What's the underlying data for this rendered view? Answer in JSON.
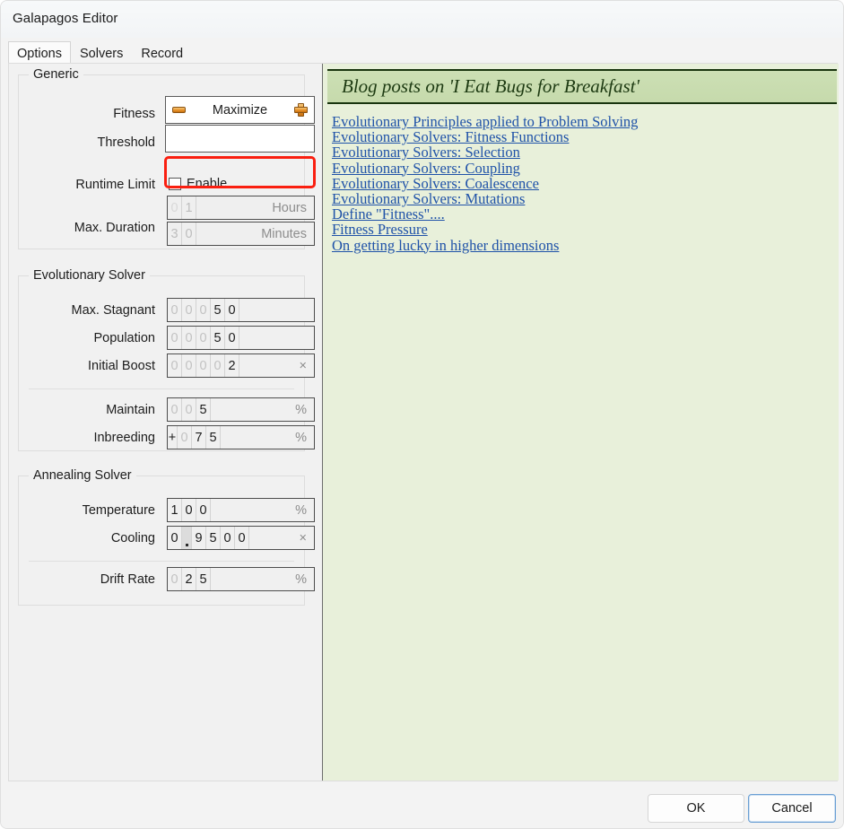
{
  "window": {
    "title": "Galapagos Editor"
  },
  "tabs": [
    {
      "label": "Options",
      "active": true
    },
    {
      "label": "Solvers",
      "active": false
    },
    {
      "label": "Record",
      "active": false
    }
  ],
  "generic": {
    "title": "Generic",
    "fitness": {
      "label": "Fitness",
      "value": "Maximize",
      "minus_icon": "minus-icon",
      "plus_icon": "plus-icon"
    },
    "threshold": {
      "label": "Threshold",
      "value": "",
      "placeholder": ""
    },
    "runtime_limit": {
      "label": "Runtime Limit",
      "checkbox_label": "Enable",
      "checked": false
    },
    "max_duration": {
      "label": "Max. Duration",
      "hours": {
        "digits": [
          "0",
          "1"
        ],
        "dim": [
          true,
          false
        ],
        "unit": "Hours",
        "disabled": true
      },
      "minutes": {
        "digits": [
          "3",
          "0"
        ],
        "dim": [
          false,
          false
        ],
        "unit": "Minutes",
        "disabled": true
      }
    }
  },
  "evolutionary": {
    "title": "Evolutionary Solver",
    "max_stagnant": {
      "label": "Max. Stagnant",
      "digits": [
        "0",
        "0",
        "0",
        "5",
        "0"
      ],
      "dim": [
        true,
        true,
        true,
        false,
        false
      ],
      "unit": ""
    },
    "population": {
      "label": "Population",
      "digits": [
        "0",
        "0",
        "0",
        "5",
        "0"
      ],
      "dim": [
        true,
        true,
        true,
        false,
        false
      ],
      "unit": ""
    },
    "initial_boost": {
      "label": "Initial Boost",
      "digits": [
        "0",
        "0",
        "0",
        "0",
        "2"
      ],
      "dim": [
        true,
        true,
        true,
        true,
        false
      ],
      "unit": "×"
    },
    "maintain": {
      "label": "Maintain",
      "digits": [
        "0",
        "0",
        "5"
      ],
      "dim": [
        true,
        true,
        false
      ],
      "unit": "%"
    },
    "inbreeding": {
      "label": "Inbreeding",
      "sign": "+",
      "digits": [
        "0",
        "7",
        "5"
      ],
      "dim": [
        true,
        false,
        false
      ],
      "unit": "%"
    }
  },
  "annealing": {
    "title": "Annealing Solver",
    "temperature": {
      "label": "Temperature",
      "digits": [
        "1",
        "0",
        "0"
      ],
      "dim": [
        false,
        false,
        false
      ],
      "unit": "%"
    },
    "cooling": {
      "label": "Cooling",
      "digits": [
        "0",
        ".",
        "9",
        "5",
        "0",
        "0"
      ],
      "dim": [
        false,
        false,
        false,
        false,
        false,
        false
      ],
      "unit": "×"
    },
    "drift_rate": {
      "label": "Drift Rate",
      "digits": [
        "0",
        "2",
        "5"
      ],
      "dim": [
        true,
        false,
        false
      ],
      "unit": "%"
    }
  },
  "blog": {
    "banner": "Blog posts on 'I Eat Bugs for Breakfast'",
    "links": [
      "Evolutionary Principles applied to Problem Solving",
      "Evolutionary Solvers: Fitness Functions",
      "Evolutionary Solvers: Selection",
      "Evolutionary Solvers: Coupling",
      "Evolutionary Solvers: Coalescence",
      "Evolutionary Solvers: Mutations",
      "Define \"Fitness\"....",
      "Fitness Pressure",
      "On getting lucky in higher dimensions"
    ]
  },
  "footer": {
    "ok_label": "OK",
    "cancel_label": "Cancel"
  },
  "colors": {
    "highlight_ring": "#fa1f10",
    "accent_orange": "#e8922a",
    "blog_background": "#e8f0da",
    "blog_banner": "#ccdfb4",
    "link": "#1f52a8"
  }
}
